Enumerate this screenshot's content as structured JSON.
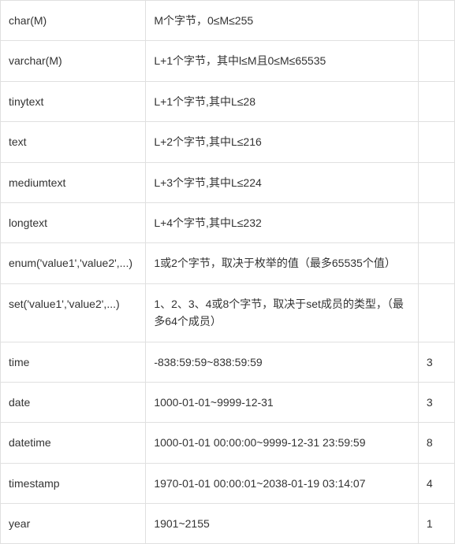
{
  "rows": [
    {
      "col1": "char(M)",
      "col2": "M个字节，0≤M≤255",
      "col3": ""
    },
    {
      "col1": "varchar(M)",
      "col2": "L+1个字节，其中l≤M且0≤M≤65535",
      "col3": ""
    },
    {
      "col1": "tinytext",
      "col2": "L+1个字节,其中L≤28",
      "col3": ""
    },
    {
      "col1": "text",
      "col2": "L+2个字节,其中L≤216",
      "col3": ""
    },
    {
      "col1": "mediumtext",
      "col2": "L+3个字节,其中L≤224",
      "col3": ""
    },
    {
      "col1": "longtext",
      "col2": "L+4个字节,其中L≤232",
      "col3": ""
    },
    {
      "col1": "enum('value1','value2',...)",
      "col2": "1或2个字节，取决于枚举的值（最多65535个值）",
      "col3": ""
    },
    {
      "col1": "set('value1','value2',...)",
      "col2": "1、2、3、4或8个字节，取决于set成员的类型，（最多64个成员）",
      "col3": ""
    },
    {
      "col1": "time",
      "col2": "-838:59:59~838:59:59",
      "col3": "3"
    },
    {
      "col1": "date",
      "col2": "1000-01-01~9999-12-31",
      "col3": "3"
    },
    {
      "col1": "datetime",
      "col2": "1000-01-01 00:00:00~9999-12-31 23:59:59",
      "col3": "8"
    },
    {
      "col1": "timestamp",
      "col2": "1970-01-01 00:00:01~2038-01-19 03:14:07",
      "col3": "4"
    },
    {
      "col1": "year",
      "col2": "1901~2155",
      "col3": "1"
    }
  ]
}
